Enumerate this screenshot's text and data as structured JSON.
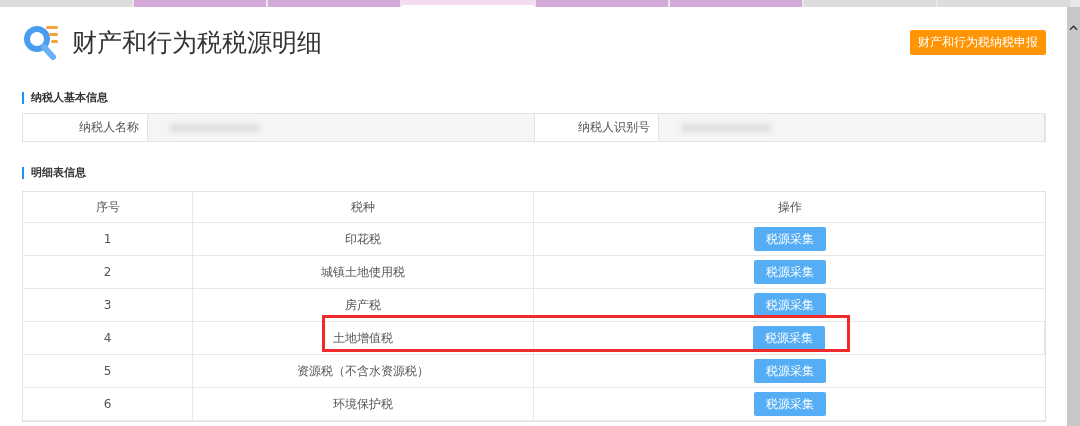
{
  "browser_tabs": [
    {
      "selected": false,
      "color": "#dcdcdc"
    },
    {
      "selected": false,
      "color": "#d4a8d8"
    },
    {
      "selected": false,
      "color": "#d4a8d8"
    },
    {
      "selected": true,
      "color": "#f3dcf3"
    },
    {
      "selected": false,
      "color": "#d4a8d8"
    },
    {
      "selected": false,
      "color": "#d4a8d8"
    },
    {
      "selected": false,
      "color": "#dcdcdc"
    },
    {
      "selected": false,
      "color": "#dcdcdc"
    }
  ],
  "page": {
    "title": "财产和行为税税源明细",
    "action_button": "财产和行为税纳税申报"
  },
  "taxpayer_section": {
    "heading": "纳税人基本信息",
    "fields": [
      {
        "label": "纳税人名称",
        "kind": "redacted"
      },
      {
        "label": "纳税人识别号",
        "kind": "redacted"
      }
    ]
  },
  "detail_section": {
    "heading": "明细表信息",
    "columns": [
      "序号",
      "税种",
      "操作"
    ],
    "rows": [
      {
        "index": "1",
        "tax": "印花税",
        "action": "税源采集",
        "highlighted": false
      },
      {
        "index": "2",
        "tax": "城镇土地使用税",
        "action": "税源采集",
        "highlighted": false
      },
      {
        "index": "3",
        "tax": "房产税",
        "action": "税源采集",
        "highlighted": false
      },
      {
        "index": "4",
        "tax": "土地增值税",
        "action": "税源采集",
        "highlighted": true
      },
      {
        "index": "5",
        "tax": "资源税（不含水资源税）",
        "action": "税源采集",
        "highlighted": false
      },
      {
        "index": "6",
        "tax": "环境保护税",
        "action": "税源采集",
        "highlighted": false
      }
    ]
  }
}
